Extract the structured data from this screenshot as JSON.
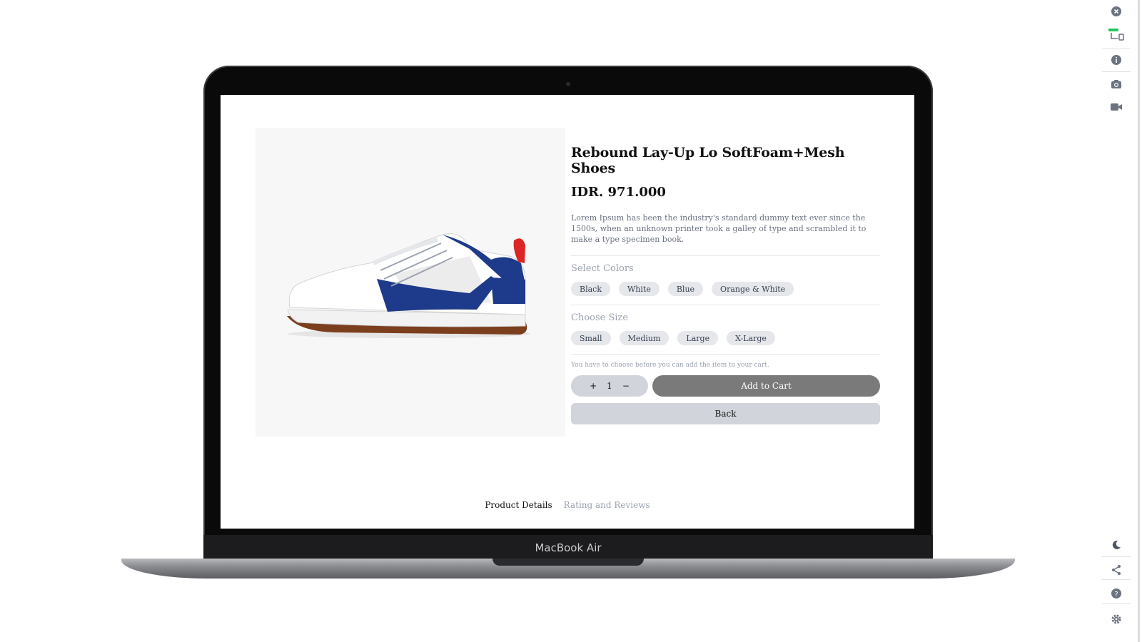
{
  "device": {
    "label": "MacBook Air"
  },
  "product": {
    "title": "Rebound Lay-Up Lo SoftFoam+Mesh Shoes",
    "price": "IDR. 971.000",
    "description": "Lorem Ipsum has been the industry's standard dummy text ever since the 1500s, when an unknown printer took a galley of type and scrambled it to make a type specimen book.",
    "image_alt": "white sneaker with blue stripe and gum sole"
  },
  "colors": {
    "label": "Select Colors",
    "options": [
      "Black",
      "White",
      "Blue",
      "Orange & White"
    ]
  },
  "sizes": {
    "label": "Choose Size",
    "options": [
      "Small",
      "Medium",
      "Large",
      "X-Large"
    ]
  },
  "cart": {
    "hint": "You have to choose before you can add the item to your cart.",
    "quantity": "1",
    "increment": "+",
    "decrement": "−",
    "add_label": "Add to Cart",
    "back_label": "Back"
  },
  "tabs": [
    {
      "label": "Product Details",
      "active": true
    },
    {
      "label": "Rating and Reviews",
      "active": false
    }
  ],
  "rail_icons": [
    "close-icon",
    "responsive-icon",
    "info-icon",
    "camera-icon",
    "video-icon",
    "moon-icon",
    "share-icon",
    "help-icon",
    "gear-icon"
  ],
  "colors_theme": {
    "accent": "#7a7a7a",
    "chip": "#e5e7eb",
    "brand_blue": "#1e3a8a",
    "brand_red": "#dc2626"
  }
}
